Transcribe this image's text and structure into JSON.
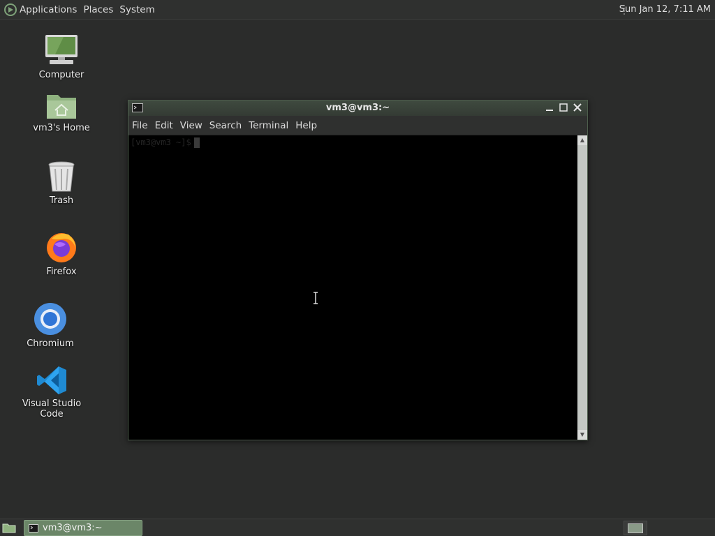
{
  "top_panel": {
    "menu": [
      "Applications",
      "Places",
      "System"
    ],
    "clock": "Sun Jan 12,  7:11 AM"
  },
  "desktop_icons": [
    {
      "label": "Computer",
      "icon": "computer-icon"
    },
    {
      "label": "vm3's Home",
      "icon": "home-folder-icon"
    },
    {
      "label": "Trash",
      "icon": "trash-icon"
    },
    {
      "label": "Firefox",
      "icon": "firefox-icon"
    },
    {
      "label": "Chromium",
      "icon": "chromium-icon"
    },
    {
      "label": "Visual Studio Code",
      "icon": "vscode-icon"
    }
  ],
  "terminal": {
    "title": "vm3@vm3:~",
    "menu": [
      "File",
      "Edit",
      "View",
      "Search",
      "Terminal",
      "Help"
    ],
    "prompt": "[vm3@vm3 ~]$"
  },
  "taskbar": {
    "items": [
      {
        "label": "vm3@vm3:~"
      }
    ]
  },
  "colors": {
    "accent": "#6b8668",
    "panel": "#2f302f",
    "desktop": "#2b2c2b"
  }
}
